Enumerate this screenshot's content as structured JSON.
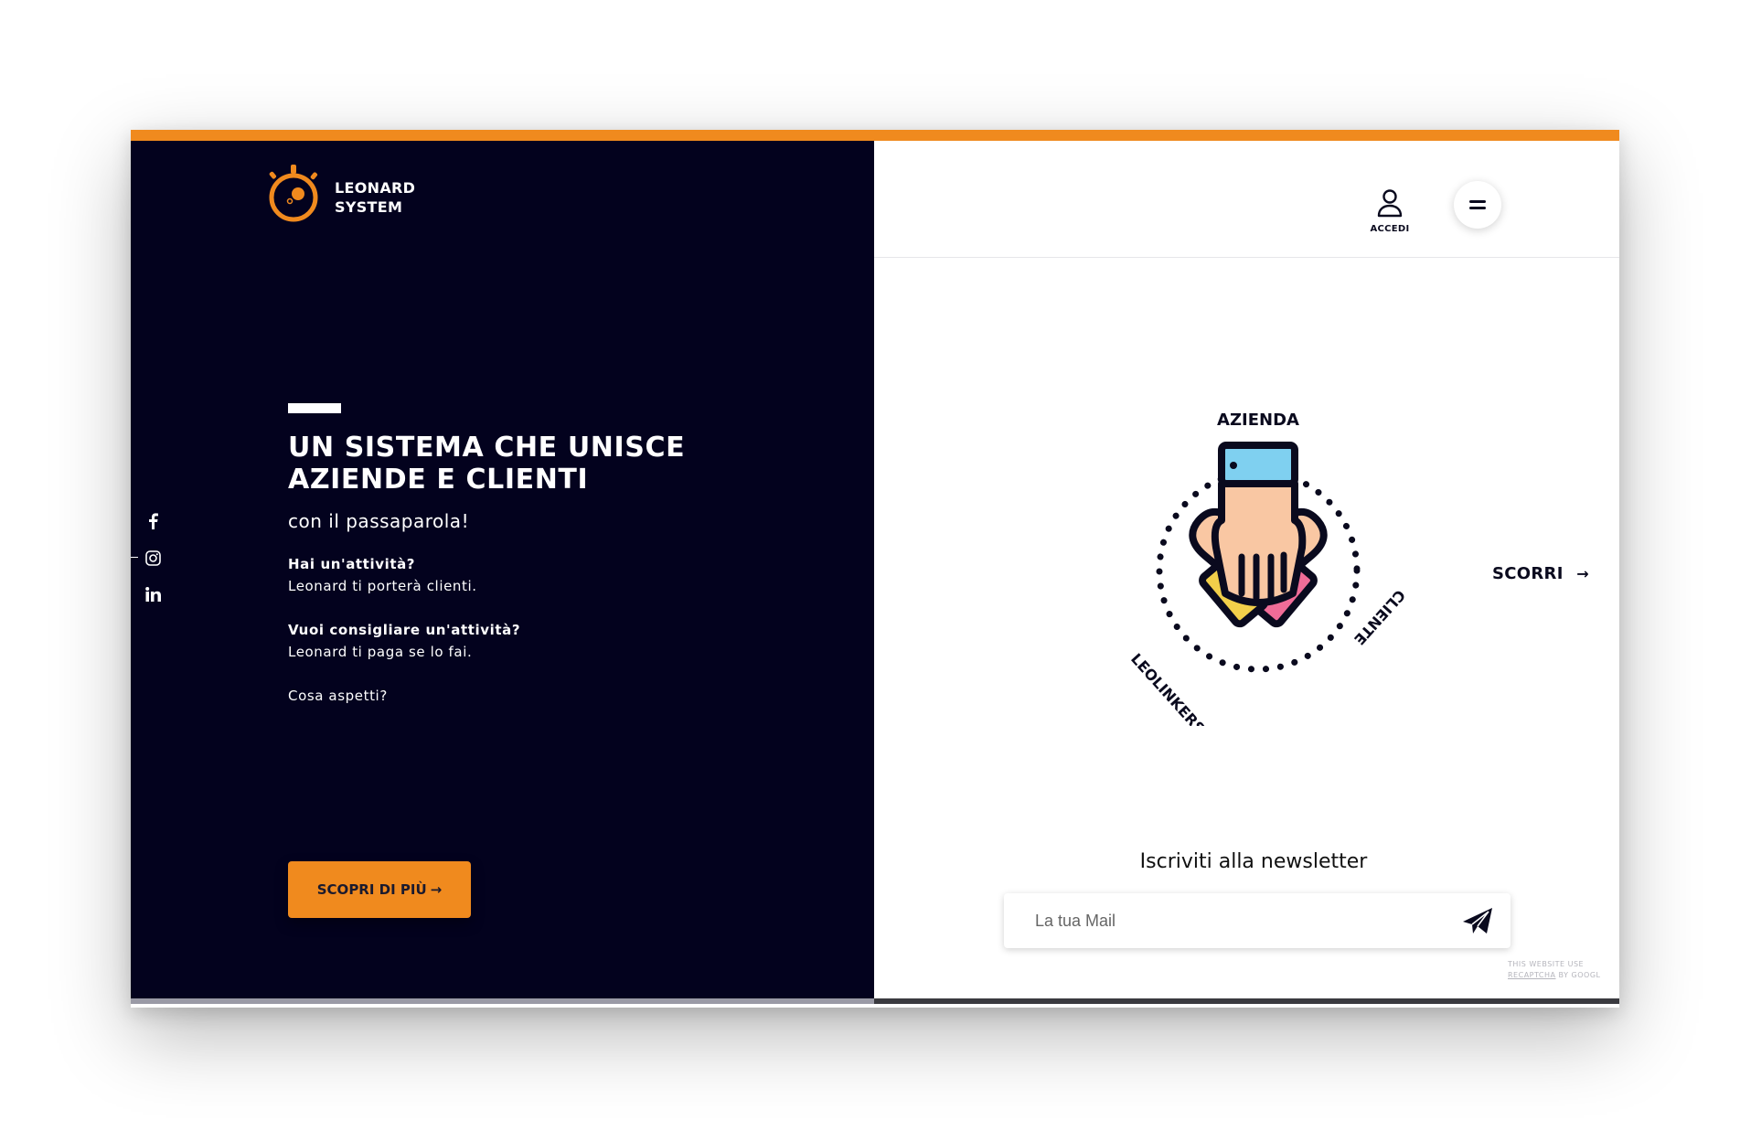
{
  "brand": {
    "line1": "LEONARD",
    "line2": "SYSTEM"
  },
  "social": [
    "facebook-icon",
    "instagram-icon",
    "linkedin-icon"
  ],
  "hero": {
    "title_line1": "UN SISTEMA CHE UNISCE",
    "title_line2": "AZIENDE E CLIENTI",
    "subtitle": "con il passaparola!",
    "q1": "Hai un'attività?",
    "a1": "Leonard ti porterà clienti.",
    "q2": "Vuoi consigliare un'attività?",
    "a2": "Leonard ti paga se lo fai.",
    "ask": "Cosa aspetti?",
    "cta": "SCOPRI DI PIÙ",
    "cta_arrow": "→"
  },
  "header": {
    "login": "ACCEDI",
    "menu_icon": "menu-icon"
  },
  "illustration": {
    "top": "AZIENDA",
    "left": "LEOLINKERS",
    "right": "CLIENTE"
  },
  "scroll": {
    "label": "SCORRI",
    "arrow": "→"
  },
  "newsletter": {
    "title": "Iscriviti alla newsletter",
    "placeholder": "La tua Mail"
  },
  "recaptcha": {
    "line1": "THIS WEBSITE USE",
    "link": "RECAPTCHA",
    "line2": "BY GOOGL"
  },
  "colors": {
    "orange": "#f08a1e",
    "navy": "#03021e"
  }
}
